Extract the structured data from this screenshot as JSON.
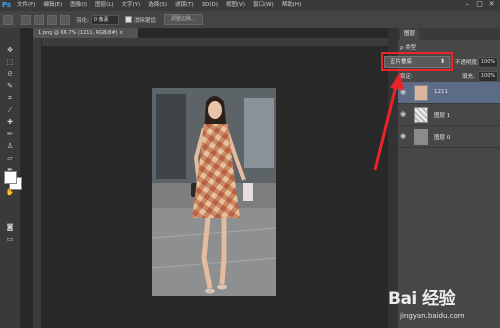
{
  "app": {
    "logo": "Ps"
  },
  "menu": [
    "文件(F)",
    "编辑(E)",
    "图像(I)",
    "图层(L)",
    "文字(Y)",
    "选择(S)",
    "滤镜(T)",
    "3D(D)",
    "视图(V)",
    "窗口(W)",
    "帮助(H)"
  ],
  "options": {
    "feather_label": "羽化:",
    "feather_value": "0 像素",
    "antialias_label": "消除锯齿",
    "refine_edge": "调整边缘..."
  },
  "window_controls": {
    "minimize": "–",
    "maximize": "□",
    "close": "✕"
  },
  "document": {
    "tab_title": "1.png @ 66.7% (1211, RGB/8#) ×"
  },
  "layers_panel": {
    "tab_label": "图层",
    "kind_label": "ρ 类型",
    "blend_mode": "正片叠底",
    "opacity_label": "不透明度:",
    "opacity_value": "100%",
    "lock_label": "锁定:",
    "fill_label": "填充:",
    "fill_value": "100%",
    "layers": [
      {
        "name": "1211"
      },
      {
        "name": "图层 1"
      },
      {
        "name": "图层 0"
      }
    ]
  },
  "watermark": {
    "brand": "Bai 经验",
    "url": "jingyan.baidu.com"
  },
  "colors": {
    "highlight": "#e8252a",
    "selected_layer": "#5c6b86",
    "ps_blue": "#31a8ff"
  },
  "icons": [
    "move-icon",
    "marquee-icon",
    "lasso-icon",
    "quick-select-icon",
    "crop-icon",
    "eyedropper-icon",
    "healing-icon",
    "brush-icon",
    "stamp-icon",
    "history-brush-icon",
    "eraser-icon",
    "gradient-icon",
    "blur-icon",
    "dodge-icon",
    "pen-icon",
    "type-icon",
    "path-select-icon",
    "shape-icon",
    "hand-icon",
    "zoom-icon",
    "eye-icon"
  ]
}
